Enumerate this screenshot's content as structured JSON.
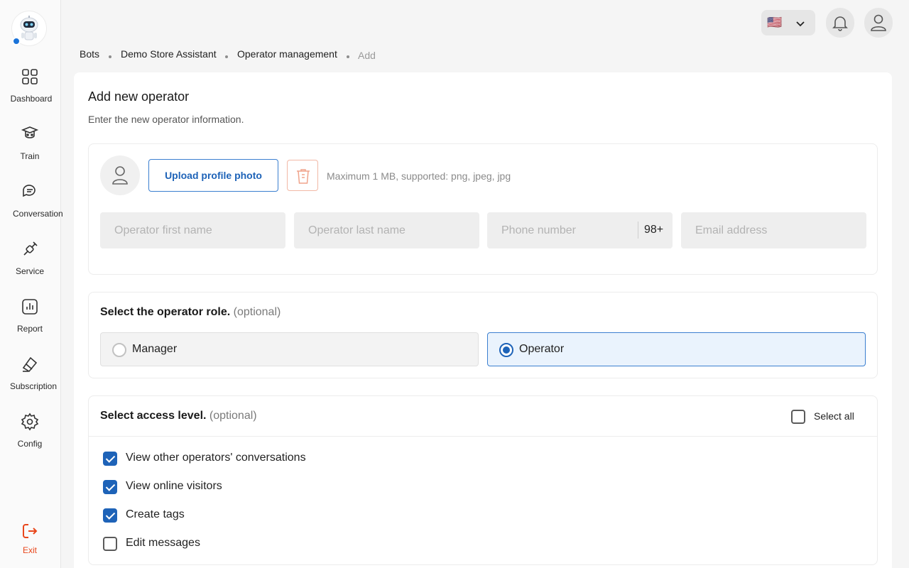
{
  "sidebar": {
    "items": [
      {
        "label": "Dashboard",
        "icon": "dashboard-icon"
      },
      {
        "label": "Train",
        "icon": "train-icon"
      },
      {
        "label": "Conversation",
        "icon": "conversation-icon"
      },
      {
        "label": "Service",
        "icon": "service-icon"
      },
      {
        "label": "Report",
        "icon": "report-icon"
      },
      {
        "label": "Subscription",
        "icon": "subscription-icon"
      },
      {
        "label": "Config",
        "icon": "config-icon"
      }
    ],
    "exit_label": "Exit"
  },
  "header": {
    "language_flag": "🇺🇸",
    "notification_icon": "bell-icon",
    "profile_icon": "user-icon"
  },
  "breadcrumb": [
    "Bots",
    "Demo Store Assistant",
    "Operator management",
    "Add"
  ],
  "page": {
    "title": "Add new operator",
    "subtitle": "Enter the new operator information."
  },
  "profile": {
    "upload_label": "Upload profile photo",
    "hint": "Maximum 1 MB, supported: png, jpeg, jpg"
  },
  "form": {
    "first_name_placeholder": "Operator first name",
    "last_name_placeholder": "Operator last name",
    "phone_placeholder": "Phone number",
    "phone_code": "98+",
    "email_placeholder": "Email address"
  },
  "role": {
    "title": "Select the operator role.",
    "optional": "(optional)",
    "options": [
      {
        "label": "Manager",
        "selected": false
      },
      {
        "label": "Operator",
        "selected": true
      }
    ]
  },
  "access": {
    "title": "Select access level.",
    "optional": "(optional)",
    "select_all_label": "Select all",
    "select_all_checked": false,
    "items": [
      {
        "label": "View other operators' conversations",
        "checked": true
      },
      {
        "label": "View online visitors",
        "checked": true
      },
      {
        "label": "Create tags",
        "checked": true
      },
      {
        "label": "Edit messages",
        "checked": false
      }
    ]
  },
  "colors": {
    "accent": "#1e63b8",
    "exit": "#e8471c",
    "danger_light": "#f2b8a6"
  }
}
